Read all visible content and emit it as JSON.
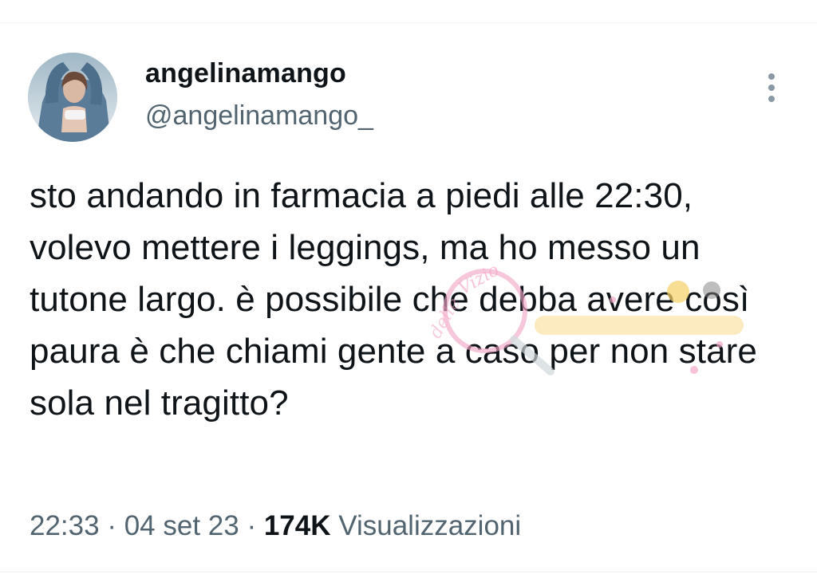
{
  "user": {
    "display_name": "angelinamango",
    "handle": "@angelinamango_",
    "avatar_icon": "profile-photo"
  },
  "tweet": {
    "text": "sto andando in farmacia a piedi alle 22:30, volevo mettere i leggings, ma ho messo un tutone largo. è possibile che debba avere così paura è che chiami gente a caso per non stare sola nel tragitto?"
  },
  "meta": {
    "time": "22:33",
    "separator": "·",
    "date": "04 set 23",
    "views_count": "174K",
    "views_label": "Visualizzazioni"
  },
  "icons": {
    "more": "more-vertical-icon"
  },
  "colors": {
    "text_primary": "#0f1419",
    "text_secondary": "#536471",
    "divider": "#eff3f4"
  }
}
